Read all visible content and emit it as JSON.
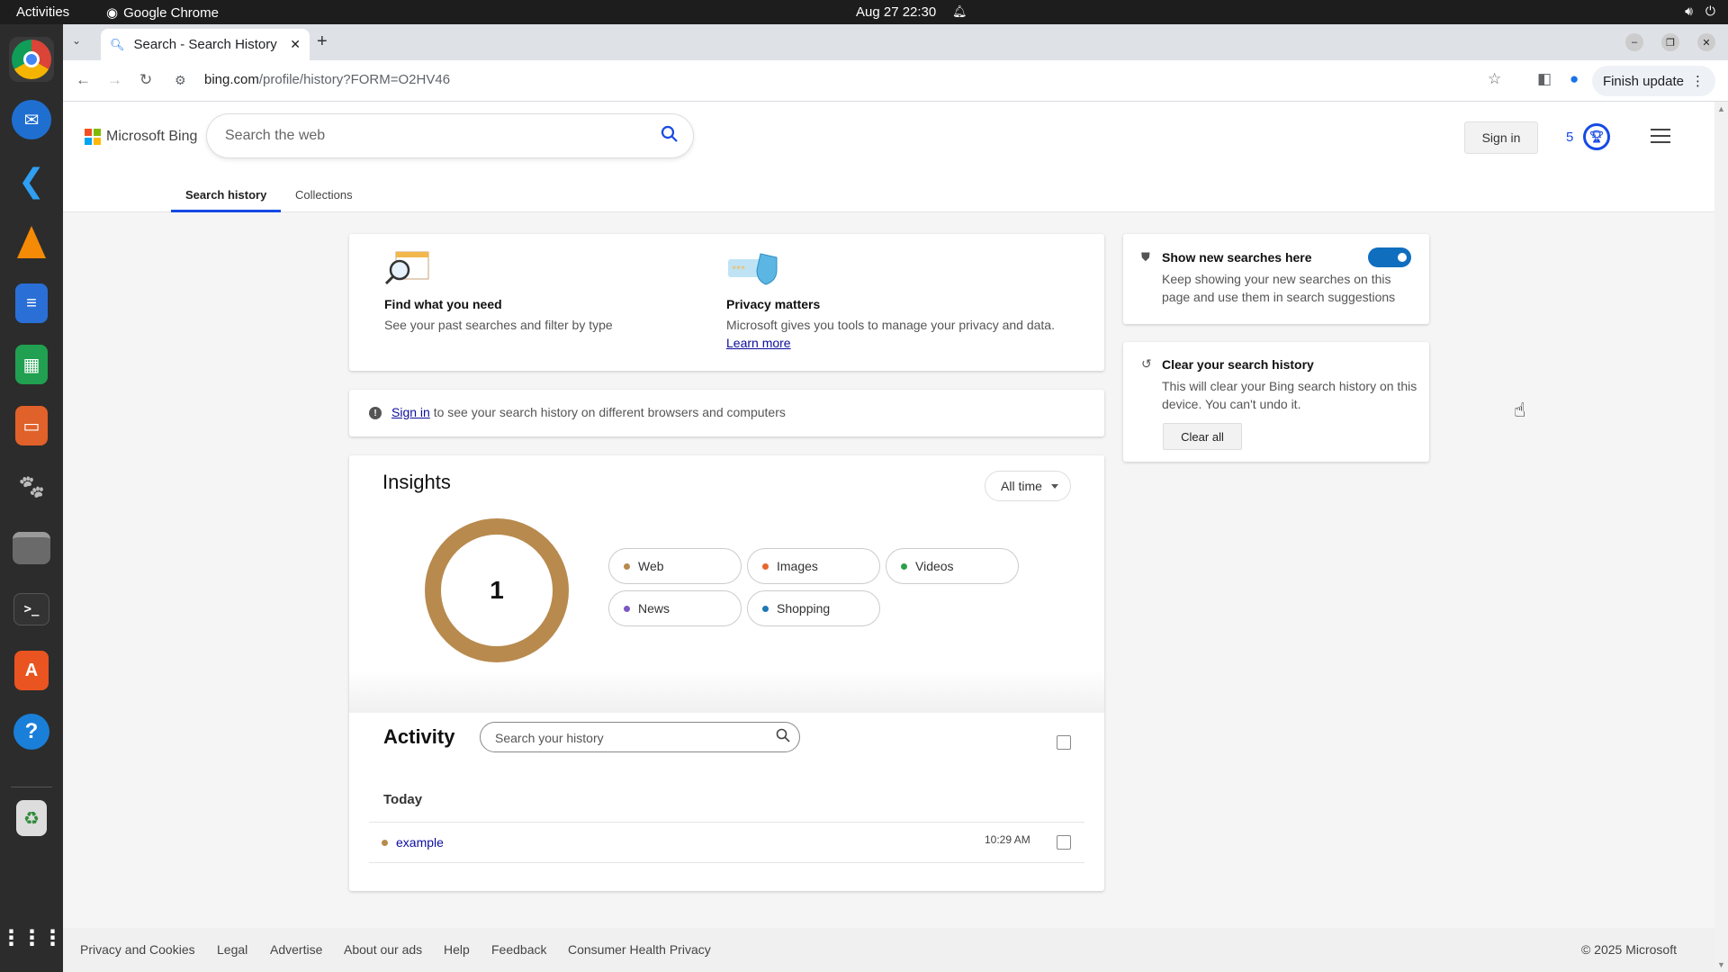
{
  "system": {
    "activities": "Activities",
    "app_name": "Google Chrome",
    "clock": "Aug 27  22:30"
  },
  "browser": {
    "tab_title": "Search - Search History",
    "url_host": "bing.com",
    "url_path": "/profile/history?FORM=O2HV46",
    "finish_update": "Finish update"
  },
  "bing": {
    "logo_text": "Microsoft Bing",
    "search_placeholder": "Search the web",
    "sign_in": "Sign in",
    "rewards_count": "5",
    "colors": {
      "accent": "#174ae4",
      "toggle": "#106ebe",
      "donut": "#b88a4e"
    }
  },
  "subnav": {
    "tabs": [
      "Search history",
      "Collections"
    ]
  },
  "intro": {
    "find": {
      "title": "Find what you need",
      "text": "See your past searches and filter by type"
    },
    "privacy": {
      "title": "Privacy matters",
      "text": "Microsoft gives you tools to manage your privacy and data.",
      "link": "Learn more"
    }
  },
  "signin_banner": {
    "link": "Sign in",
    "text": "to see your search history on different browsers and computers"
  },
  "insights": {
    "title": "Insights",
    "range": "All time",
    "total": "1",
    "categories": [
      {
        "label": "Web",
        "color": "#b88a4e"
      },
      {
        "label": "Images",
        "color": "#e8652f"
      },
      {
        "label": "Videos",
        "color": "#2e9e49"
      },
      {
        "label": "News",
        "color": "#7b59c4"
      },
      {
        "label": "Shopping",
        "color": "#1f78b4"
      }
    ]
  },
  "activity": {
    "title": "Activity",
    "search_placeholder": "Search your history",
    "group": "Today",
    "items": [
      {
        "query": "example",
        "time": "10:29 AM"
      }
    ]
  },
  "side": {
    "show_new": {
      "title": "Show new searches here",
      "text": "Keep showing your new searches on this page and use them in search suggestions",
      "enabled": true
    },
    "clear": {
      "title": "Clear your search history",
      "text": "This will clear your Bing search history on this device. You can't undo it.",
      "button": "Clear all"
    }
  },
  "footer": {
    "links": [
      "Privacy and Cookies",
      "Legal",
      "Advertise",
      "About our ads",
      "Help",
      "Feedback",
      "Consumer Health Privacy"
    ],
    "copyright": "© 2025 Microsoft"
  },
  "dock_apps": [
    "chrome-icon",
    "thunderbird-icon",
    "vscode-icon",
    "vlc-icon",
    "writer-icon",
    "calc-icon",
    "impress-icon",
    "gimp-icon",
    "files-icon",
    "terminal-icon",
    "app-center-icon",
    "help-icon",
    "trash-icon",
    "show-apps-icon"
  ]
}
